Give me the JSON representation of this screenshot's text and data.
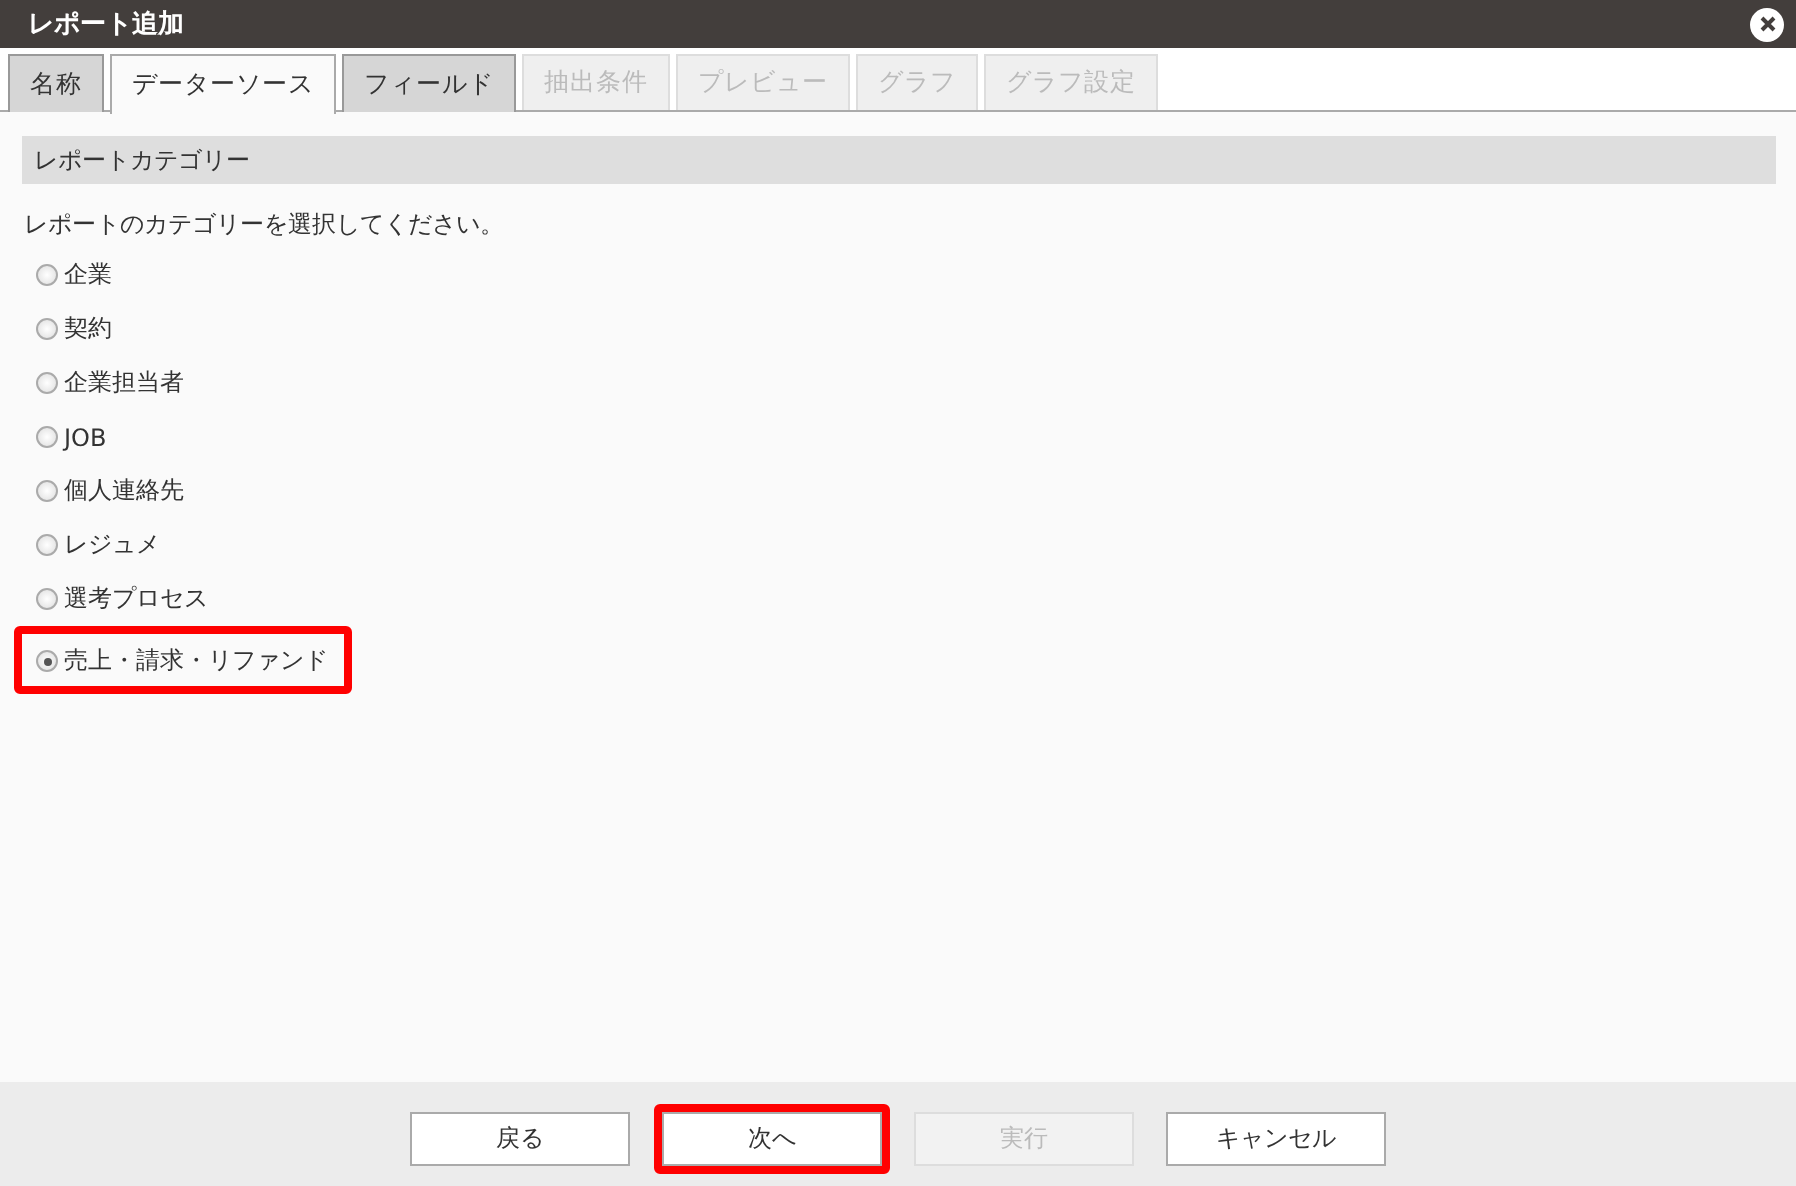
{
  "window": {
    "title": "レポート追加"
  },
  "tabs": [
    {
      "label": "名称",
      "selected": false,
      "disabled": false
    },
    {
      "label": "データーソース",
      "selected": true,
      "disabled": false
    },
    {
      "label": "フィールド",
      "selected": false,
      "disabled": false
    },
    {
      "label": "抽出条件",
      "selected": false,
      "disabled": true
    },
    {
      "label": "プレビュー",
      "selected": false,
      "disabled": true
    },
    {
      "label": "グラフ",
      "selected": false,
      "disabled": true
    },
    {
      "label": "グラフ設定",
      "selected": false,
      "disabled": true
    }
  ],
  "section": {
    "title": "レポートカテゴリー",
    "instruction": "レポートのカテゴリーを選択してください。"
  },
  "categories": [
    {
      "label": "企業",
      "selected": false,
      "highlighted": false
    },
    {
      "label": "契約",
      "selected": false,
      "highlighted": false
    },
    {
      "label": "企業担当者",
      "selected": false,
      "highlighted": false
    },
    {
      "label": "JOB",
      "selected": false,
      "highlighted": false
    },
    {
      "label": "個人連絡先",
      "selected": false,
      "highlighted": false
    },
    {
      "label": "レジュメ",
      "selected": false,
      "highlighted": false
    },
    {
      "label": "選考プロセス",
      "selected": false,
      "highlighted": false
    },
    {
      "label": "売上・請求・リファンド",
      "selected": true,
      "highlighted": true
    }
  ],
  "buttons": [
    {
      "label": "戻る",
      "disabled": false,
      "highlighted": false
    },
    {
      "label": "次へ",
      "disabled": false,
      "highlighted": true
    },
    {
      "label": "実行",
      "disabled": true,
      "highlighted": false
    },
    {
      "label": "キャンセル",
      "disabled": false,
      "highlighted": false
    }
  ]
}
